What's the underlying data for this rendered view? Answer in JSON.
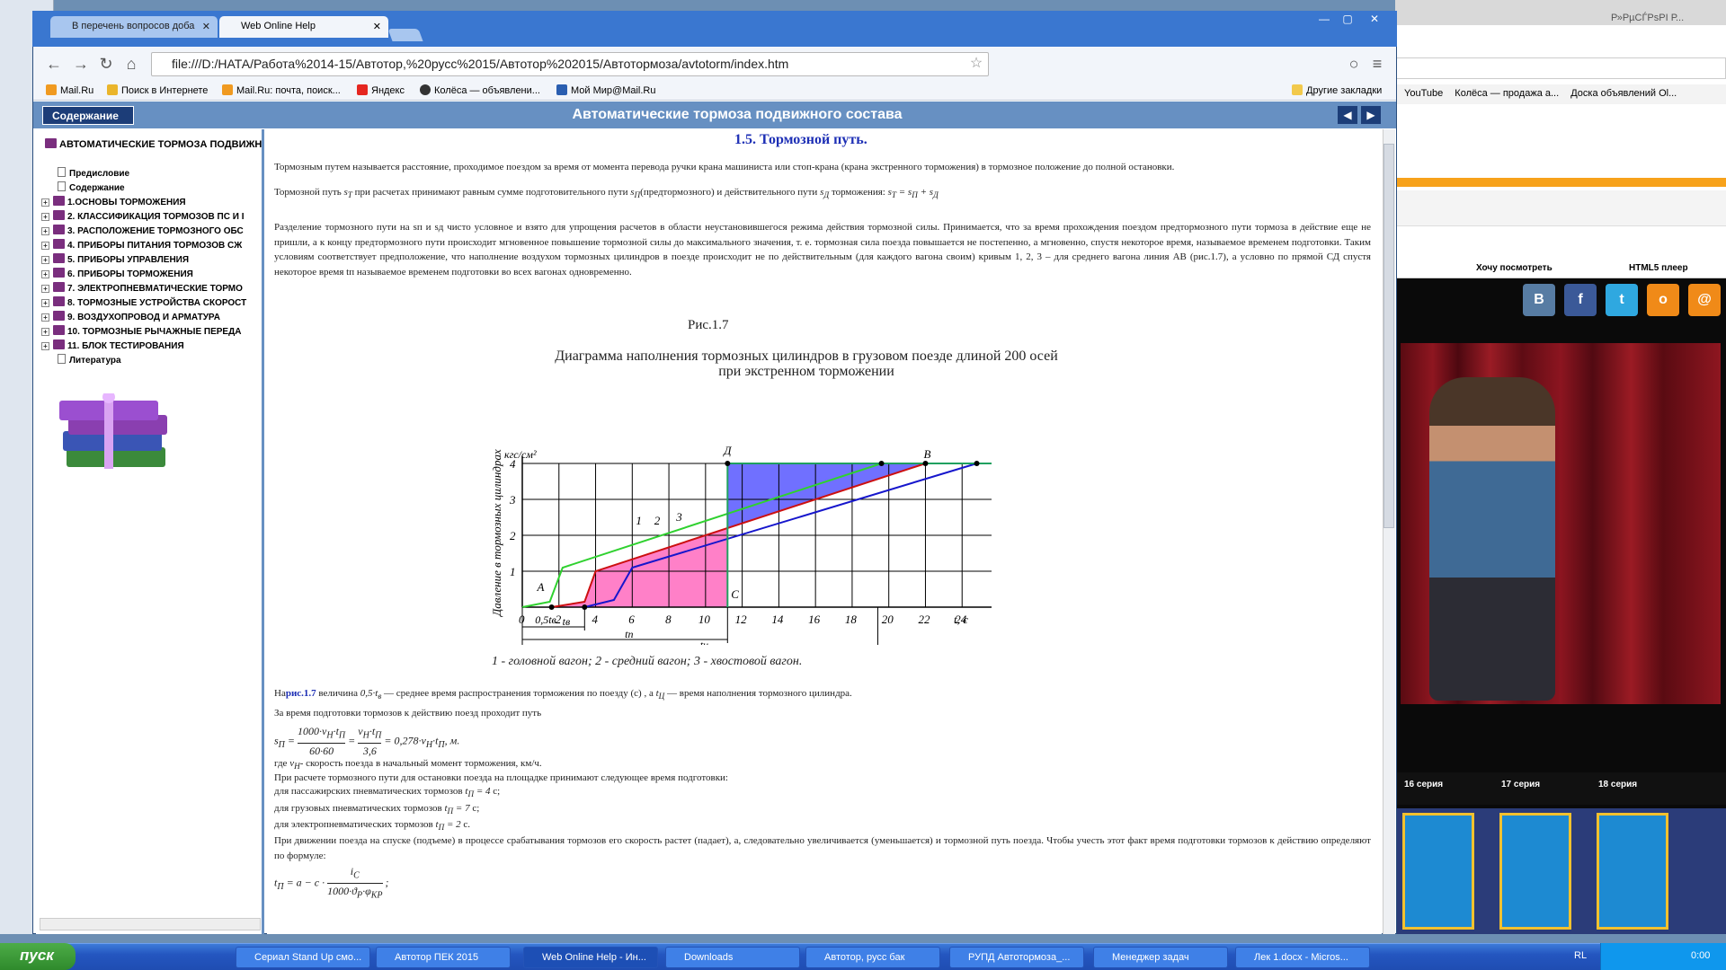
{
  "browser": {
    "tabs": [
      {
        "label": "В перечень вопросов доба"
      },
      {
        "label": "Web Online Help"
      }
    ],
    "address": "file:///D:/НАТА/Работа%2014-15/Автотор,%20русс%2015/Автотор%202015/Автотормоза/avtotorm/index.htm",
    "bookmarks": [
      "Mail.Ru",
      "Поиск в Интернете",
      "Mail.Ru: почта, поиск...",
      "Яндекс",
      "Колёса — объявлени...",
      "Мой Мир@Mail.Ru"
    ],
    "other_bookmarks": "Другие закладки"
  },
  "help": {
    "contents_btn": "Содержание",
    "title": "Автоматические тормоза подвижного состава",
    "toc_root": "АВТОМАТИЧЕСКИЕ ТОРМОЗА ПОДВИЖНО",
    "toc": [
      {
        "label": "Предисловие",
        "kind": "page"
      },
      {
        "label": "Содержание",
        "kind": "page"
      },
      {
        "label": "1.ОСНОВЫ ТОРМОЖЕНИЯ",
        "kind": "book"
      },
      {
        "label": "2. КЛАССИФИКАЦИЯ ТОРМОЗОВ ПС И I",
        "kind": "book"
      },
      {
        "label": "3. РАСПОЛОЖЕНИЕ ТОРМОЗНОГО ОБС",
        "kind": "book"
      },
      {
        "label": "4. ПРИБОРЫ ПИТАНИЯ ТОРМОЗОВ СЖ",
        "kind": "book"
      },
      {
        "label": "5. ПРИБОРЫ УПРАВЛЕНИЯ",
        "kind": "book"
      },
      {
        "label": "6. ПРИБОРЫ ТОРМОЖЕНИЯ",
        "kind": "book"
      },
      {
        "label": "7. ЭЛЕКТРОПНЕВМАТИЧЕСКИЕ ТОРМО",
        "kind": "book"
      },
      {
        "label": "8. ТОРМОЗНЫЕ УСТРОЙСТВА СКОРОСТ",
        "kind": "book"
      },
      {
        "label": "9. ВОЗДУХОПРОВОД И АРМАТУРА",
        "kind": "book"
      },
      {
        "label": "10. ТОРМОЗНЫЕ РЫЧАЖНЫЕ ПЕРЕДА",
        "kind": "book"
      },
      {
        "label": "11. БЛОК ТЕСТИРОВАНИЯ",
        "kind": "book"
      },
      {
        "label": "Литература",
        "kind": "page"
      }
    ],
    "section_title": "1.5. Тормозной путь.",
    "p1": "Тормозным путем называется расстояние, проходимое поездом за время от момента перевода ручки крана машиниста или стоп-крана (крана экстренного торможения) в тормозное положение до полной остановки.",
    "p2a": "Тормозной путь",
    "p2b": "при расчетах принимают равным сумме подготовительного пути",
    "p2c": "(предтормозного) и действительного пути",
    "p2d": "торможения:",
    "p3": "Разделение тормозного пути на sп и sд чисто условное и взято для упрощения расчетов в области неустановившегося режима действия тормозной силы. Принимается, что за время прохождения поездом предтормозного пути тормоза в действие еще не пришли, а к концу предтормозного пути происходит мгновенное повышение тормозной силы до максимального значения, т. е. тормозная сила поезда повышается не постепенно, а мгновенно, спустя некоторое время, называемое временем подготовки. Таким условиям соответствует предположение, что наполнение воздухом тормозных цилиндров в поезде происходит не по действительным (для каждого вагона своим) кривым 1, 2, 3 – для среднего вагона линия АВ (рис.1.7), а условно по прямой СД спустя некоторое время tп называемое временем подготовки во всех вагонах одновременно.",
    "fig_label": "Рис.1.7",
    "fig_title1": "Диаграмма наполнения тормозных цилиндров в грузовом поезде длиной 200 осей",
    "fig_title2": "при экстренном торможении",
    "fig_caption": "1 - головной вагон; 2 - средний вагон; 3 - хвостовой вагон.",
    "p4a": "На",
    "p4link": "рис.1.7",
    "p4b": "величина",
    "p4c": "— среднее время распространения торможения по поезду (с) , а",
    "p4d": "— время наполнения тормозного цилиндра.",
    "p5": "За время подготовки тормозов к действию поезд проходит путь",
    "p6": "где",
    "p6b": "- скорость поезда в начальный момент торможения, км/ч.",
    "p7": "При расчете тормозного пути для остановки поезда на площадке принимают следующее время подготовки:",
    "p8": "для пассажирских пневматических тормозов",
    "p8v": "с;",
    "p9": "для грузовых пневматических тормозов",
    "p9v": "с;",
    "p10": "для электропневматических тормозов",
    "p10v": "с.",
    "p11": "При движении поезда на спуске (подъеме) в процессе срабатывания тормозов его скорость растет (падает), а, следовательно увеличивается (уменьшается) и тормозной путь поезда. Чтобы учесть этот факт время подготовки тормозов к действию определяют по формуле:"
  },
  "chart_data": {
    "type": "line",
    "title": "Диаграмма наполнения тормозных цилиндров в грузовом поезде длиной 200 осей при экстренном торможении",
    "xlabel": "t, c",
    "ylabel": "Давление в тормозных цилиндрах",
    "yunit": "кгс/см²",
    "xlim": [
      0,
      26
    ],
    "ylim": [
      0,
      4
    ],
    "xticks": [
      0,
      2,
      4,
      6,
      8,
      10,
      12,
      14,
      16,
      18,
      20,
      22,
      24
    ],
    "yticks": [
      0,
      1,
      2,
      3,
      4
    ],
    "xtick_label_0_5": "0,5tв",
    "point_labels": {
      "A": "А",
      "C": "С",
      "D": "Д",
      "B": "В"
    },
    "interval_labels": [
      "tв",
      "tп",
      "tц"
    ],
    "series": [
      {
        "name": "1",
        "color": "#2fd12f",
        "x": [
          0,
          1.5,
          2.2,
          19.6
        ],
        "y": [
          0,
          0.15,
          1.1,
          4
        ]
      },
      {
        "name": "2",
        "color": "#cc1010",
        "x": [
          1.6,
          3.4,
          4.0,
          22.0
        ],
        "y": [
          0,
          0.15,
          1.0,
          4
        ]
      },
      {
        "name": "3",
        "color": "#1616cc",
        "x": [
          3.4,
          5.0,
          6.0,
          24.8
        ],
        "y": [
          0,
          0.2,
          1.1,
          4
        ]
      },
      {
        "name": "СД",
        "color": "#20a060",
        "x": [
          11.2,
          11.2,
          26
        ],
        "y": [
          0,
          4,
          4
        ]
      }
    ],
    "fill_colors": {
      "pink": "#ff80c8",
      "blue": "#7070ff"
    }
  },
  "taskbar": {
    "start": "пуск",
    "tasks": [
      "Сериал Stand Up смо...",
      "Автотор ПЕК 2015",
      "Web Online Help - Ин...",
      "Downloads",
      "Автотор, русс бак",
      "РУПД Автотормоза_...",
      "Менеджер задач",
      "Лек 1.docx - Micros..."
    ],
    "lang": "RL",
    "clock": "0:00"
  },
  "bg": {
    "bookmarks": [
      "YouTube",
      "Колёса — продажа а...",
      "Доска объявлений Ol..."
    ],
    "tabs": [
      "Хочу посмотреть",
      "HTML5 плеер"
    ],
    "series": [
      "16 серия",
      "17 серия",
      "18 серия"
    ],
    "title": "Р»РµСЃРѕРІ Р..."
  }
}
